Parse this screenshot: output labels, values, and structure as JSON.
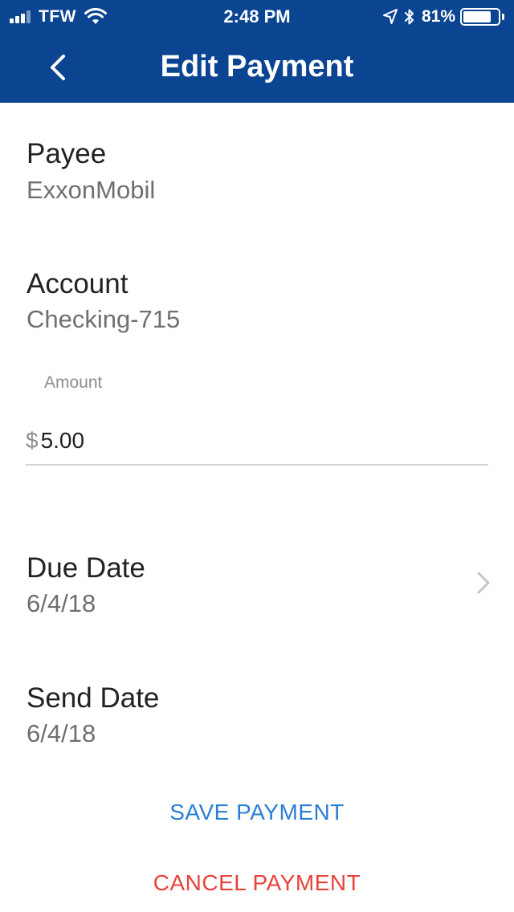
{
  "status_bar": {
    "carrier": "TFW",
    "time": "2:48 PM",
    "battery_percent": "81%",
    "battery_level": 0.81
  },
  "nav": {
    "title": "Edit Payment",
    "back_icon": "chevron-left-icon"
  },
  "payee": {
    "label": "Payee",
    "value": "ExxonMobil"
  },
  "account": {
    "label": "Account",
    "value": "Checking-715"
  },
  "amount": {
    "label": "Amount",
    "currency": "$",
    "value": "5.00"
  },
  "due_date": {
    "label": "Due Date",
    "value": "6/4/18",
    "chevron_icon": "chevron-right-icon"
  },
  "send_date": {
    "label": "Send Date",
    "value": "6/4/18"
  },
  "actions": {
    "save_label": "SAVE PAYMENT",
    "cancel_label": "CANCEL PAYMENT"
  },
  "colors": {
    "header_bg": "#0b4591",
    "save": "#2a7fd4",
    "cancel": "#e8433a"
  }
}
